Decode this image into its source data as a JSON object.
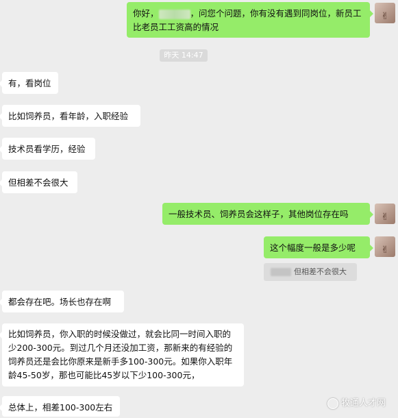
{
  "messages": {
    "m1_before": "你好，",
    "m1_after": "，问您个问题，你有没有遇到同岗位，新员工比老员工工资高的情况",
    "timestamp": "昨天 14:47",
    "m2": "有，看岗位",
    "m3": "比如饲养员，看年龄，入职经验",
    "m4": "技术员看学历，经验",
    "m5": "但相差不会很大",
    "m6": "一般技术员、饲养员会这样子，其他岗位存在吗",
    "m7": "这个幅度一般是多少呢",
    "quote": "但相差不会很大",
    "m8": "都会存在吧。场长也存在啊",
    "m9": "比如饲养员，你入职的时候没做过，就会比同一时间入职的少200-300元。到过几个月还没加工资，那新来的有经验的饲养员还是会比你原来是新手多100-300元。如果你入职年龄45-50岁，那也可能比45岁以下少100-300元，",
    "m10": "总体上，相差100-300左右"
  },
  "watermark": "牧通人才网",
  "colors": {
    "background": "#ededed",
    "sent_bubble": "#95ec69",
    "received_bubble": "#ffffff"
  },
  "avatar_icon": "avatar-peace-sign-icon"
}
